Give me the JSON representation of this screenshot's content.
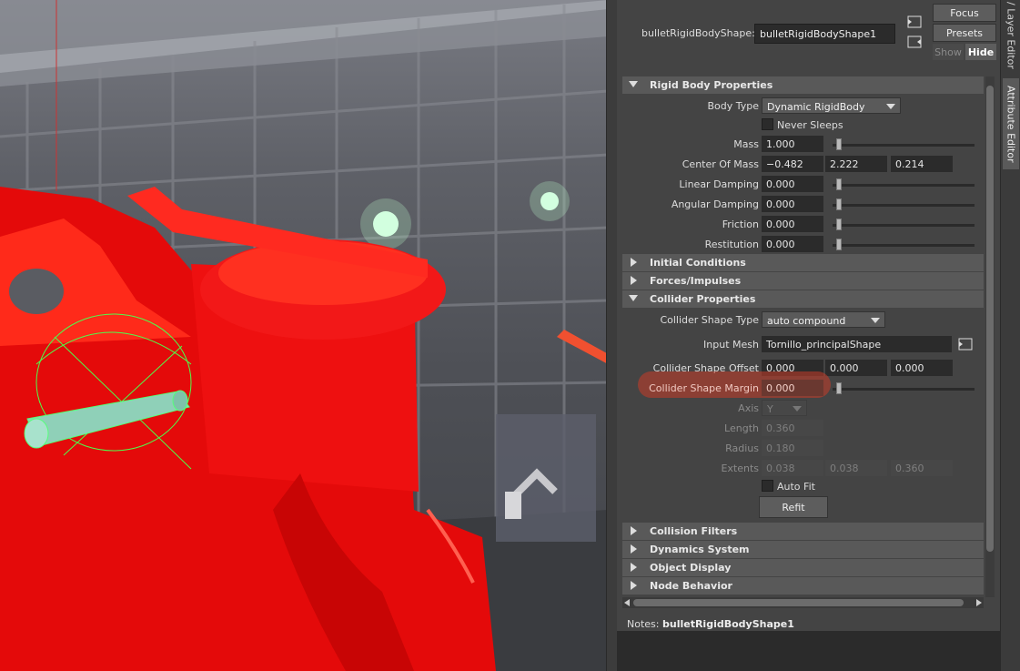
{
  "header": {
    "node_label": "bulletRigidBodyShape:",
    "node_value": "bulletRigidBodyShape1",
    "focus_label": "Focus",
    "presets_label": "Presets",
    "show_label": "Show",
    "hide_label": "Hide"
  },
  "side_tabs": [
    "/ Layer Editor",
    "Attribute Editor"
  ],
  "rigid_body_properties": {
    "title": "Rigid Body Properties",
    "body_type_label": "Body Type",
    "body_type_value": "Dynamic RigidBody",
    "never_sleeps_label": "Never Sleeps",
    "mass_label": "Mass",
    "mass_value": "1.000",
    "center_of_mass_label": "Center Of Mass",
    "center_of_mass_values": [
      "−0.482",
      "2.222",
      "0.214"
    ],
    "linear_damping_label": "Linear Damping",
    "linear_damping_value": "0.000",
    "angular_damping_label": "Angular Damping",
    "angular_damping_value": "0.000",
    "friction_label": "Friction",
    "friction_value": "0.000",
    "restitution_label": "Restitution",
    "restitution_value": "0.000"
  },
  "sections_closed_1": [
    "Initial Conditions",
    "Forces/Impulses"
  ],
  "collider_properties": {
    "title": "Collider Properties",
    "collider_shape_type_label": "Collider Shape Type",
    "collider_shape_type_value": "auto compound",
    "input_mesh_label": "Input Mesh",
    "input_mesh_value": "Tornillo_principalShape",
    "collider_shape_offset_label": "Collider Shape Offset",
    "collider_shape_offset_values": [
      "0.000",
      "0.000",
      "0.000"
    ],
    "collider_shape_margin_label": "Collider Shape Margin",
    "collider_shape_margin_value": "0.000",
    "axis_label": "Axis",
    "axis_value": "Y",
    "length_label": "Length",
    "length_value": "0.360",
    "radius_label": "Radius",
    "radius_value": "0.180",
    "extents_label": "Extents",
    "extents_values": [
      "0.038",
      "0.038",
      "0.360"
    ],
    "auto_fit_label": "Auto Fit",
    "refit_label": "Refit"
  },
  "sections_closed_2": [
    "Collision Filters",
    "Dynamics System",
    "Object Display",
    "Node Behavior"
  ],
  "notes": {
    "label": "Notes:",
    "node": "bulletRigidBodyShape1"
  }
}
